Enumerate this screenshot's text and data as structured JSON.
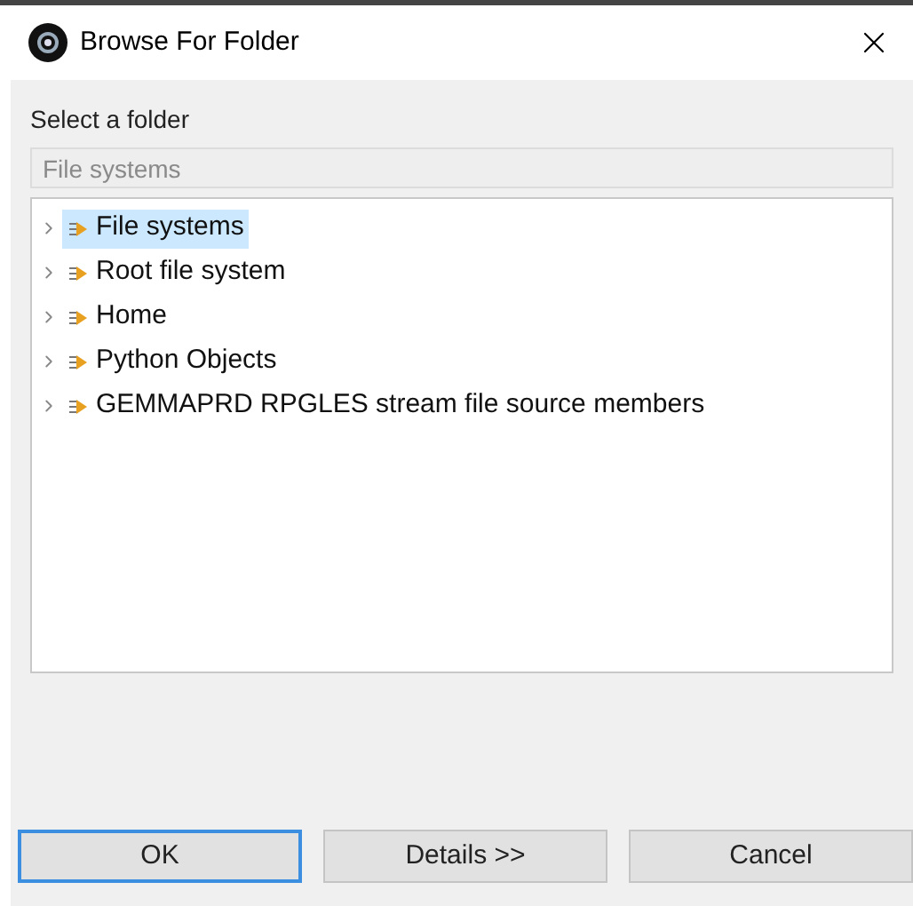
{
  "window": {
    "title": "Browse For Folder"
  },
  "prompt": "Select a folder",
  "path_field": {
    "value": "File systems",
    "disabled": true
  },
  "tree": [
    {
      "label": "File systems",
      "selected": true,
      "expanded": false
    },
    {
      "label": "Root file system",
      "selected": false,
      "expanded": false
    },
    {
      "label": "Home",
      "selected": false,
      "expanded": false
    },
    {
      "label": "Python Objects",
      "selected": false,
      "expanded": false
    },
    {
      "label": "GEMMAPRD RPGLES stream file source members",
      "selected": false,
      "expanded": false
    }
  ],
  "buttons": [
    {
      "label": "OK",
      "default": true
    },
    {
      "label": "Details >>",
      "default": false
    },
    {
      "label": "Cancel",
      "default": false
    }
  ]
}
